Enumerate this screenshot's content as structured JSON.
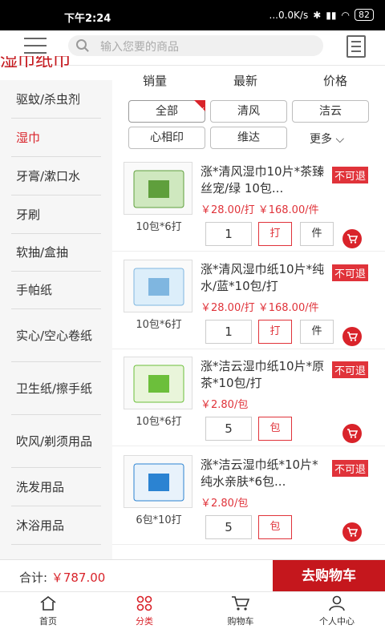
{
  "status_bar": {
    "time": "下午2:24",
    "network": "...0.0K/s",
    "battery": "82"
  },
  "search": {
    "placeholder": "输入您要的商品"
  },
  "category_title": "湿巾纸巾",
  "sidebar": {
    "items": [
      {
        "label": "驱蚊/杀虫剂",
        "active": false
      },
      {
        "label": "湿巾",
        "active": true
      },
      {
        "label": "牙膏/漱口水",
        "active": false
      },
      {
        "label": "牙刷",
        "active": false
      },
      {
        "label": "软抽/盒抽",
        "active": false
      },
      {
        "label": "手帕纸",
        "active": false
      },
      {
        "label": "实心/空心卷纸",
        "active": false
      },
      {
        "label": "卫生纸/擦手纸",
        "active": false
      },
      {
        "label": "吹风/剃须用品",
        "active": false
      },
      {
        "label": "洗发用品",
        "active": false
      },
      {
        "label": "沐浴用品",
        "active": false
      }
    ]
  },
  "sort": {
    "sales": "销量",
    "newest": "最新",
    "price": "价格"
  },
  "filters": {
    "chips": [
      "全部",
      "清风",
      "洁云",
      "心相印",
      "维达"
    ],
    "selected": "全部",
    "more": "更多"
  },
  "products": [
    {
      "name": "涨*清风湿巾10片*茶臻丝宠/绿 10包...",
      "spec": "10包*6打",
      "badge": "不可退",
      "price": "￥28.00/打  ￥168.00/件",
      "qty": "1",
      "units": [
        "打",
        "件"
      ],
      "selected_unit": "打"
    },
    {
      "name": "涨*清风湿巾纸10片*纯水/蓝*10包/打",
      "spec": "10包*6打",
      "badge": "不可退",
      "price": "￥28.00/打  ￥168.00/件",
      "qty": "1",
      "units": [
        "打",
        "件"
      ],
      "selected_unit": "打"
    },
    {
      "name": "涨*洁云湿巾纸10片*原茶*10包/打",
      "spec": "10包*6打",
      "badge": "不可退",
      "price": "￥2.80/包",
      "qty": "5",
      "units": [
        "包"
      ],
      "selected_unit": "包"
    },
    {
      "name": "涨*洁云湿巾纸*10片*纯水亲肤*6包...",
      "spec": "6包*10打",
      "badge": "不可退",
      "price": "￥2.80/包",
      "qty": "5",
      "units": [
        "包"
      ],
      "selected_unit": "包"
    }
  ],
  "cart": {
    "total_label": "合计:",
    "total_value": "￥787.00",
    "checkout": "去购物车"
  },
  "tabs": [
    {
      "label": "首页",
      "icon": "home-icon",
      "active": false
    },
    {
      "label": "分类",
      "icon": "category-icon",
      "active": true
    },
    {
      "label": "购物车",
      "icon": "cart-icon",
      "active": false
    },
    {
      "label": "个人中心",
      "icon": "user-icon",
      "active": false
    }
  ],
  "colors": {
    "accent": "#d9232a",
    "checkout_bg": "#c5171d"
  }
}
